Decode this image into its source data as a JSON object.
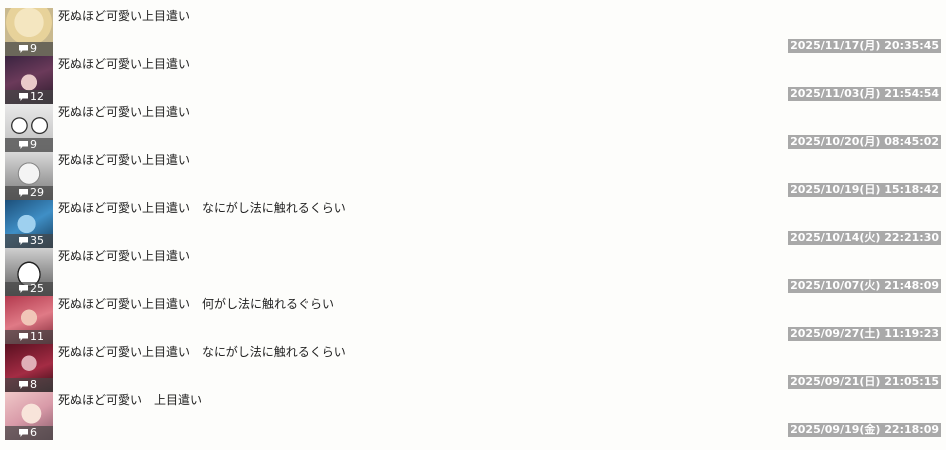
{
  "colors": {
    "background": "#fdfdfb",
    "timestamp_bg": "#a9a9a9",
    "badge_bg": "#464646",
    "text": "#222222"
  },
  "posts": [
    {
      "title": "死ぬほど可愛い上目遣い",
      "comments": "9",
      "timestamp": "2025/11/17(月) 20:35:45",
      "thumb_icon": "thumbnail-blonde-girl"
    },
    {
      "title": "死ぬほど可愛い上目遣い",
      "comments": "12",
      "timestamp": "2025/11/03(月) 21:54:54",
      "thumb_icon": "thumbnail-dark-hair-girl"
    },
    {
      "title": "死ぬほど可愛い上目遣い",
      "comments": "9",
      "timestamp": "2025/10/20(月) 08:45:02",
      "thumb_icon": "thumbnail-manga-faces"
    },
    {
      "title": "死ぬほど可愛い上目遣い",
      "comments": "29",
      "timestamp": "2025/10/19(日) 15:18:42",
      "thumb_icon": "thumbnail-manga-girl"
    },
    {
      "title": "死ぬほど可愛い上目遣い　なにがし法に触れるくらい",
      "comments": "35",
      "timestamp": "2025/10/14(火) 22:21:30",
      "thumb_icon": "thumbnail-blue-anime"
    },
    {
      "title": "死ぬほど可愛い上目遣い",
      "comments": "25",
      "timestamp": "2025/10/07(火) 21:48:09",
      "thumb_icon": "thumbnail-manga-grin"
    },
    {
      "title": "死ぬほど可愛い上目遣い　何がし法に触れるぐらい",
      "comments": "11",
      "timestamp": "2025/09/27(土) 11:19:23",
      "thumb_icon": "thumbnail-red-hair-girl"
    },
    {
      "title": "死ぬほど可愛い上目遣い　なにがし法に触れるくらい",
      "comments": "8",
      "timestamp": "2025/09/21(日) 21:05:15",
      "thumb_icon": "thumbnail-dark-red-girl"
    },
    {
      "title": "死ぬほど可愛い　上目遣い",
      "comments": "6",
      "timestamp": "2025/09/19(金) 22:18:09",
      "thumb_icon": "thumbnail-pink-girl"
    }
  ]
}
